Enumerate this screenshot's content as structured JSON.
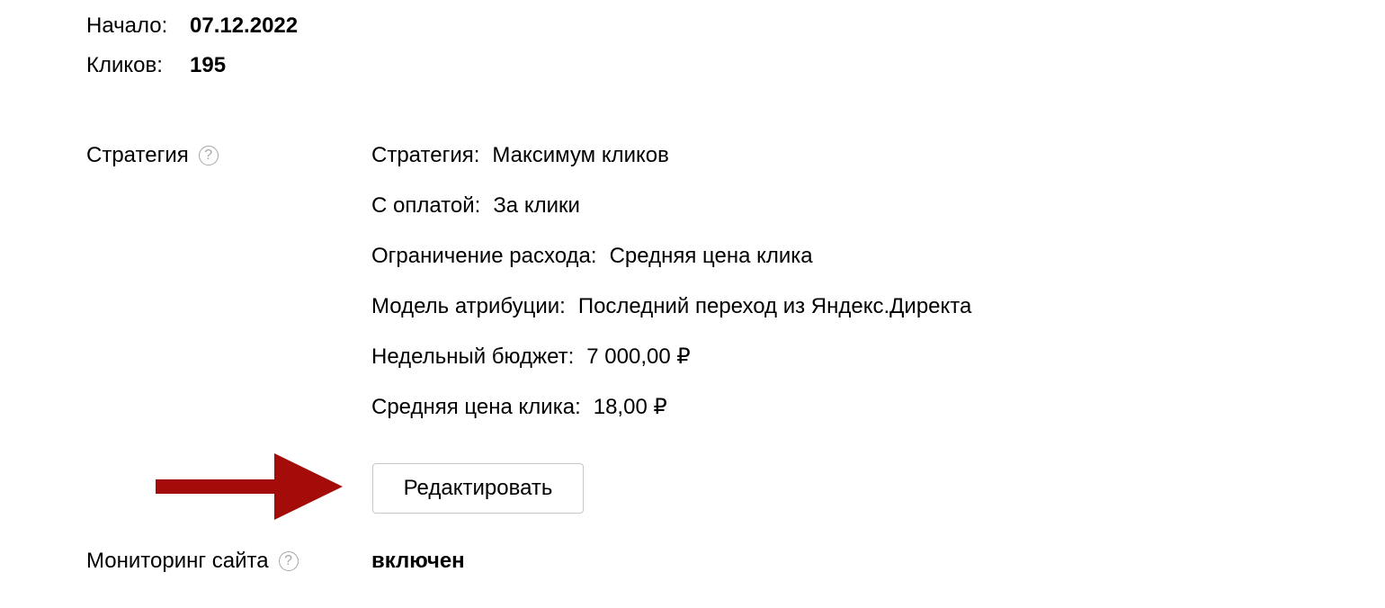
{
  "summary": {
    "start_label": "Начало:",
    "start_value": "07.12.2022",
    "clicks_label": "Кликов:",
    "clicks_value": "195"
  },
  "strategy": {
    "section_label": "Стратегия",
    "help_glyph": "?",
    "rows": [
      {
        "label": "Стратегия:",
        "value": "Максимум кликов"
      },
      {
        "label": "С оплатой:",
        "value": "За клики"
      },
      {
        "label": "Ограничение расхода:",
        "value": "Средняя цена клика"
      },
      {
        "label": "Модель атрибуции:",
        "value": "Последний переход из Яндекс.Директа"
      },
      {
        "label": "Недельный бюджет:",
        "value": "7 000,00 ₽"
      },
      {
        "label": "Средняя цена клика:",
        "value": "18,00 ₽"
      }
    ],
    "edit_button_label": "Редактировать"
  },
  "monitoring": {
    "section_label": "Мониторинг сайта",
    "help_glyph": "?",
    "value": "включен"
  },
  "colors": {
    "arrow": "#a30c08",
    "help_icon": "#a6a6a6",
    "button_border": "#c7c7c7"
  },
  "icons": {
    "help": "question-circle-icon",
    "annotation": "red-arrow-right"
  }
}
